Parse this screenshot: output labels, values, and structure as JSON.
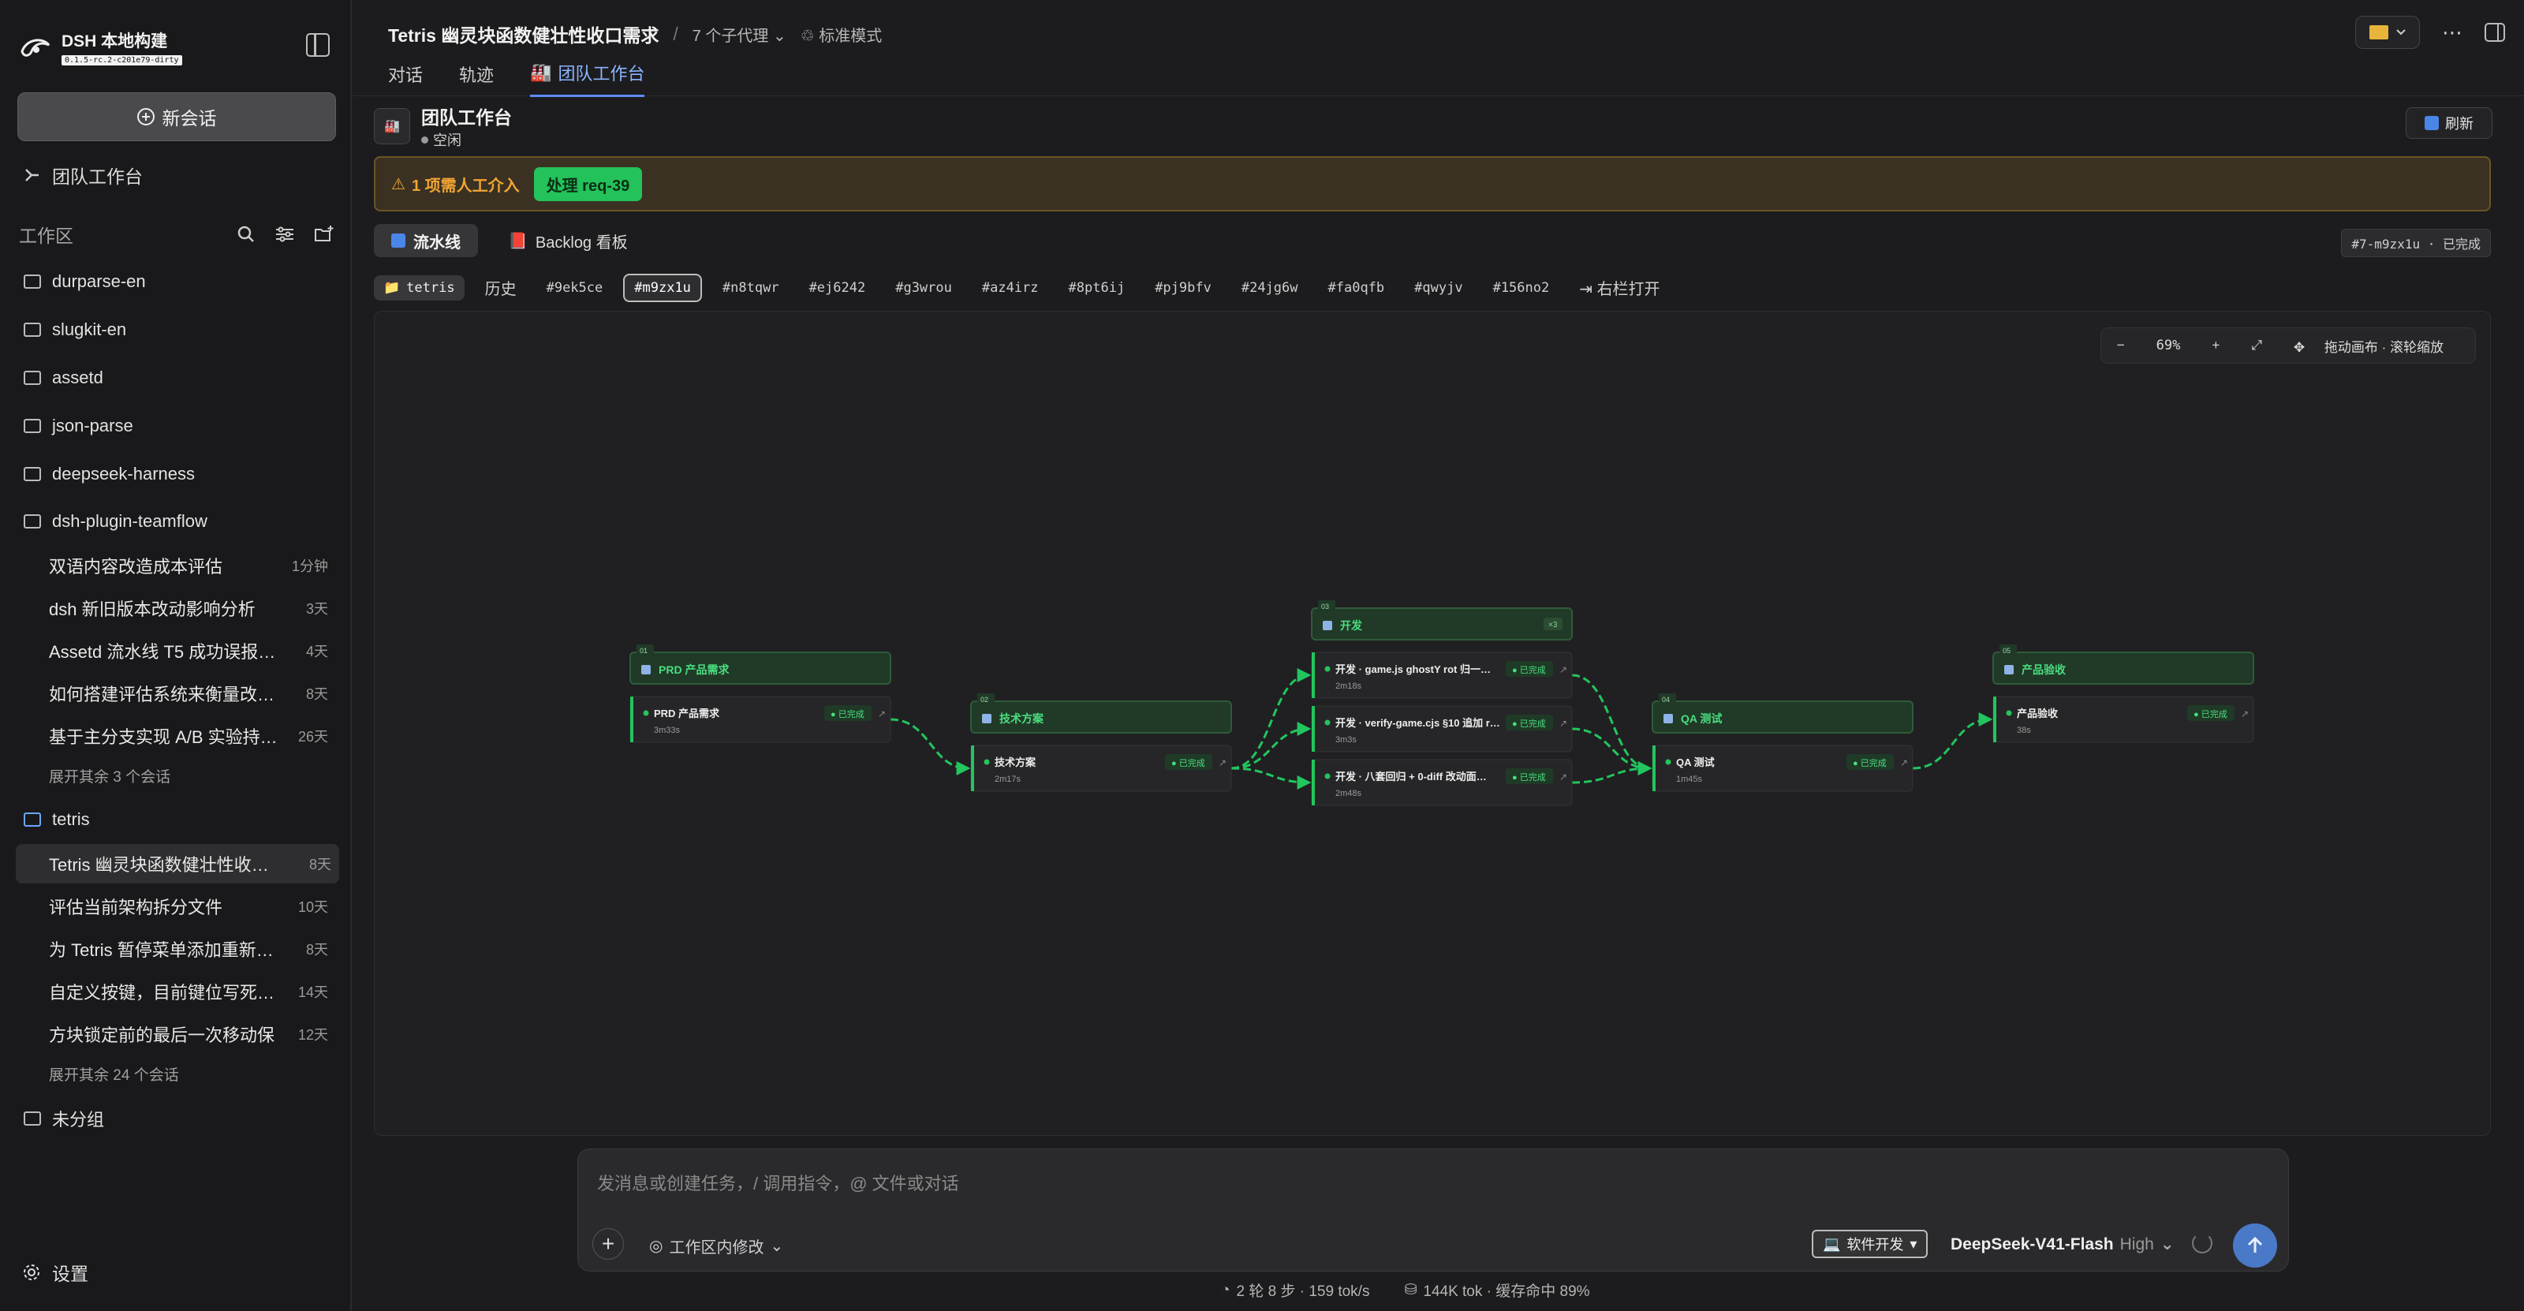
{
  "app": {
    "name": "DSH 本地构建",
    "version": "0.1.5-rc.2-c201e79-dirty"
  },
  "sidebar": {
    "new_chat": "新会话",
    "team_workspace": "团队工作台",
    "workspace_label": "工作区",
    "folders_top": [
      "durparse-en",
      "slugkit-en",
      "assetd",
      "json-parse",
      "deepseek-harness"
    ],
    "plugin_folder": "dsh-plugin-teamflow",
    "plugin_sessions": [
      {
        "title": "双语内容改造成本评估",
        "age": "1分钟"
      },
      {
        "title": "dsh 新旧版本改动影响分析",
        "age": "3天"
      },
      {
        "title": "Assetd 流水线 T5 成功误报失败",
        "age": "4天"
      },
      {
        "title": "如何搭建评估系统来衡量改动…",
        "age": "8天"
      },
      {
        "title": "基于主分支实现 A/B 实验持…",
        "age": "26天"
      }
    ],
    "plugin_expand": "展开其余 3 个会话",
    "tetris_folder": "tetris",
    "tetris_sessions": [
      {
        "title": "Tetris 幽灵块函数健壮性收口…",
        "age": "8天"
      },
      {
        "title": "评估当前架构拆分文件",
        "age": "10天"
      },
      {
        "title": "为 Tetris 暂停菜单添加重新开…",
        "age": "8天"
      },
      {
        "title": "自定义按键，目前键位写死，…",
        "age": "14天"
      },
      {
        "title": "方块锁定前的最后一次移动保",
        "age": "12天"
      }
    ],
    "tetris_expand": "展开其余 24 个会话",
    "ungrouped": "未分组",
    "settings": "设置"
  },
  "header": {
    "title": "Tetris 幽灵块函数健壮性收口需求",
    "sep": "/",
    "agents": "7 个子代理",
    "mode": "标准模式",
    "tabs": [
      "对话",
      "轨迹",
      "团队工作台"
    ]
  },
  "workbench": {
    "title": "团队工作台",
    "status": "空闲",
    "refresh": "刷新",
    "alert_text": "1 项需人工介入",
    "alert_action": "处理 req-39",
    "view_tabs": [
      "流水线",
      "Backlog 看板"
    ],
    "run_badge": "#7-m9zx1u · 已完成",
    "project_chip": "tetris",
    "history": "历史",
    "runs": [
      "#9ek5ce",
      "#m9zx1u",
      "#n8tqwr",
      "#ej6242",
      "#g3wrou",
      "#az4irz",
      "#8pt6ij",
      "#pj9bfv",
      "#24jg6w",
      "#fa0qfb",
      "#qwyjv",
      "#156no2"
    ],
    "open_right": "右栏打开",
    "zoom_minus": "−",
    "zoom_pct": "69%",
    "zoom_plus": "+",
    "zoom_hint": "拖动画布 · 滚轮缩放"
  },
  "pipeline": {
    "done_label": "已完成",
    "stages": [
      {
        "num": "01",
        "name": "PRD 产品需求",
        "tasks": [
          {
            "title": "PRD 产品需求",
            "time": "3m33s"
          }
        ]
      },
      {
        "num": "02",
        "name": "技术方案",
        "tasks": [
          {
            "title": "技术方案",
            "time": "2m17s"
          }
        ]
      },
      {
        "num": "03",
        "name": "开发",
        "count": "×3",
        "tasks": [
          {
            "title": "开发 · game.js ghostY rot 归一…",
            "time": "2m18s"
          },
          {
            "title": "开发 · verify-game.cjs §10 追加 r…",
            "time": "3m3s"
          },
          {
            "title": "开发 · 八套回归 + 0-diff 改动面…",
            "time": "2m48s"
          }
        ]
      },
      {
        "num": "04",
        "name": "QA 测试",
        "tasks": [
          {
            "title": "QA 测试",
            "time": "1m45s"
          }
        ]
      },
      {
        "num": "05",
        "name": "产品验收",
        "tasks": [
          {
            "title": "产品验收",
            "time": "38s"
          }
        ]
      }
    ]
  },
  "composer": {
    "placeholder": "发消息或创建任务，/ 调用指令，@ 文件或对话",
    "ws_mode": "工作区内修改",
    "soft_mode": "软件开发",
    "model": "DeepSeek-V41-Flash",
    "level": "High"
  },
  "footer": {
    "rounds": "2 轮 8 步 · 159 tok/s",
    "tokens": "144K tok · 缓存命中 89%"
  },
  "colors": {
    "accent": "#5b8cf5",
    "green": "#23c25a",
    "alert_orange": "#f2a534"
  }
}
